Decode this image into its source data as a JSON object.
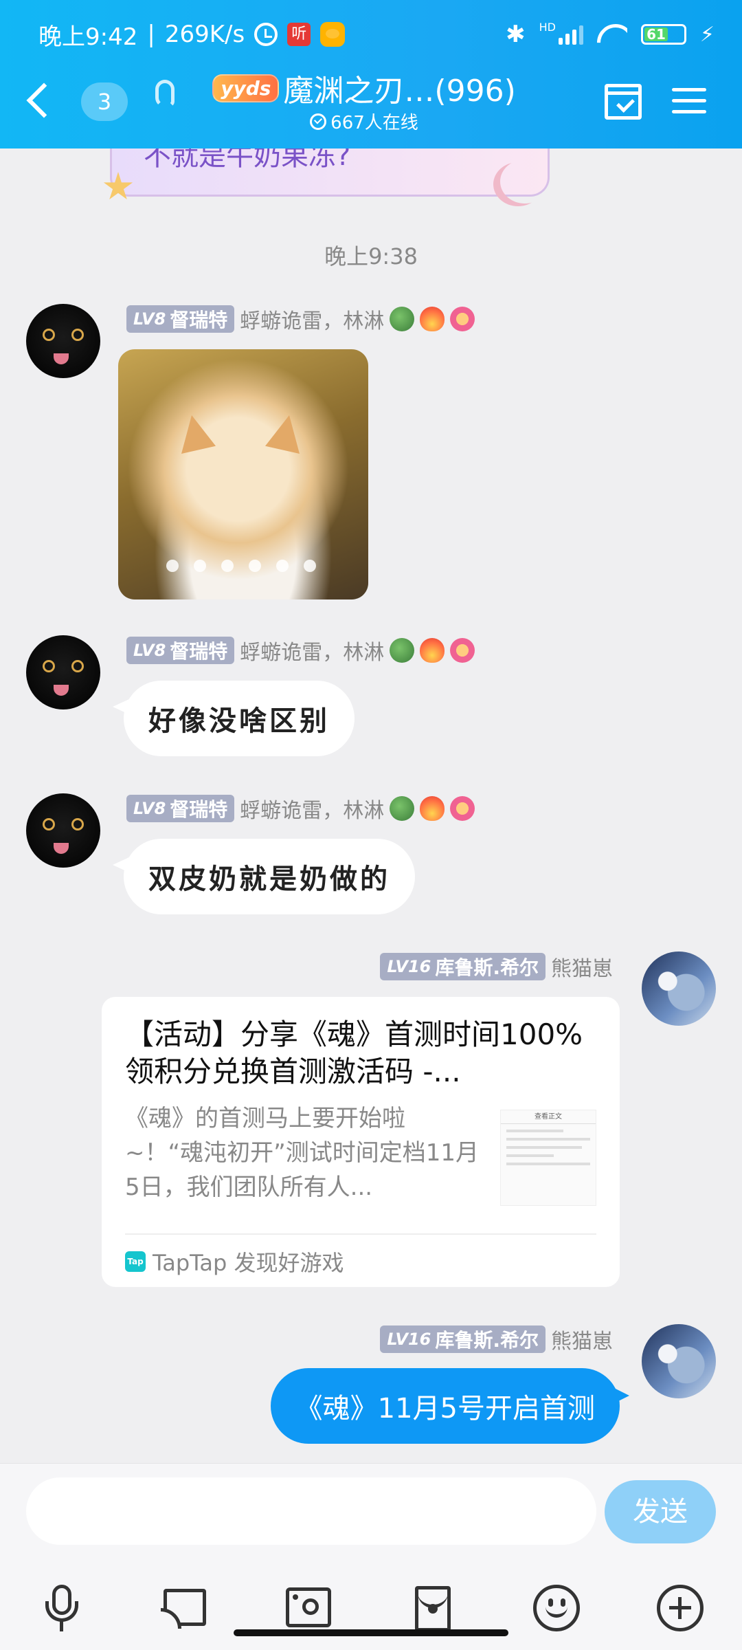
{
  "status_bar": {
    "time": "晚上9:42",
    "speed": "269K/s",
    "network_label": "HD",
    "battery_level": "61",
    "icons": [
      "alarm-icon",
      "listen-app-icon",
      "duck-app-icon",
      "bluetooth-icon",
      "signal-icon",
      "wifi-icon",
      "battery-icon",
      "charging-icon"
    ]
  },
  "header": {
    "back_label": "<",
    "unread_count": "3",
    "badge": "yyds",
    "group_name": "魔渊之刃…(996)",
    "online_count": "667人在线",
    "accent_color": "#12b7f5"
  },
  "partial_message": {
    "text": "不就是牛奶果冻?"
  },
  "timestamp": "晚上9:38",
  "messages": [
    {
      "type": "image",
      "level": "LV8",
      "title": "督瑞特",
      "nick": "蜉蝣诡雷，林淋",
      "image_dots": 6
    },
    {
      "type": "text",
      "level": "LV8",
      "title": "督瑞特",
      "nick": "蜉蝣诡雷，林淋",
      "text": "好像没啥区别"
    },
    {
      "type": "text",
      "level": "LV8",
      "title": "督瑞特",
      "nick": "蜉蝣诡雷，林淋",
      "text": "双皮奶就是奶做的"
    },
    {
      "type": "card",
      "level": "LV16",
      "title": "库鲁斯.希尔",
      "nick": "熊猫崽",
      "card_title": "【活动】分享《魂》首测时间100%领积分兑换首测激活码 -...",
      "card_desc": "《魂》的首测马上要开始啦~！“魂沌初开”测试时间定档11月5日，我们团队所有人...",
      "card_thumb_header": "查看正文",
      "card_source": "TapTap 发现好游戏",
      "card_source_icon": "Tap"
    },
    {
      "type": "text",
      "level": "LV16",
      "title": "库鲁斯.希尔",
      "nick": "熊猫崽",
      "text": "《魂》11月5号开启首测"
    }
  ],
  "input": {
    "placeholder": "",
    "value": "",
    "send_label": "发送"
  },
  "toolbar": [
    "mic-icon",
    "screen-cast-icon",
    "photo-icon",
    "red-packet-icon",
    "emoji-icon",
    "plus-icon"
  ]
}
